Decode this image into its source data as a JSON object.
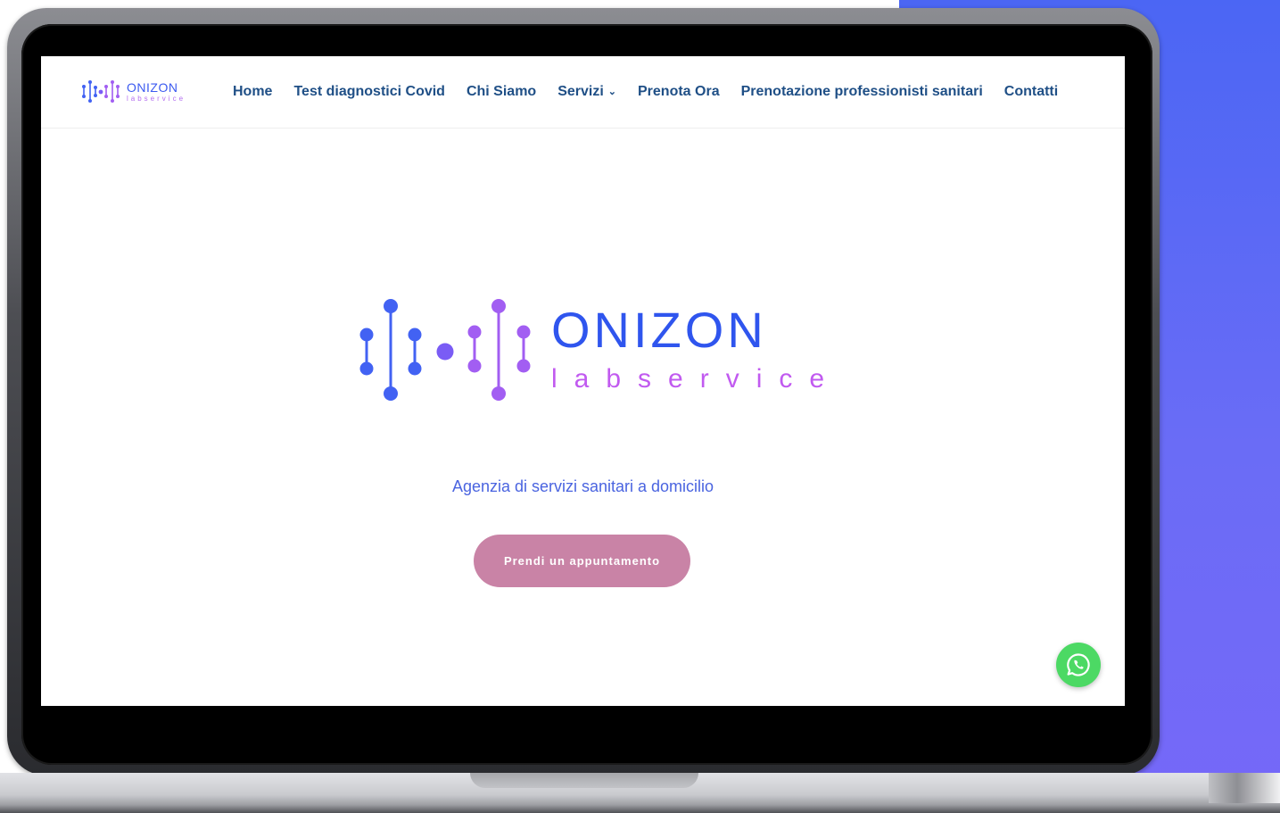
{
  "brand": {
    "name": "ONIZON",
    "subtitle": "labservice"
  },
  "nav": {
    "items": [
      {
        "label": "Home"
      },
      {
        "label": "Test diagnostici Covid"
      },
      {
        "label": "Chi Siamo"
      },
      {
        "label": "Servizi",
        "has_dropdown": true
      },
      {
        "label": "Prenota Ora"
      },
      {
        "label": "Prenotazione professionisti sanitari"
      },
      {
        "label": "Contatti"
      }
    ]
  },
  "hero": {
    "tagline": "Agenzia di servizi sanitari a domicilio",
    "cta_label": "Prendi un appuntamento"
  },
  "colors": {
    "brand_blue": "#2f55ee",
    "brand_purple": "#c15af0",
    "nav_text": "#1f4f86",
    "cta_bg": "#c983a6",
    "whatsapp_green": "#4cd964",
    "backdrop": "#6a6cf6"
  },
  "icons": {
    "dropdown": "chevron-down-icon",
    "chat": "whatsapp-icon"
  }
}
